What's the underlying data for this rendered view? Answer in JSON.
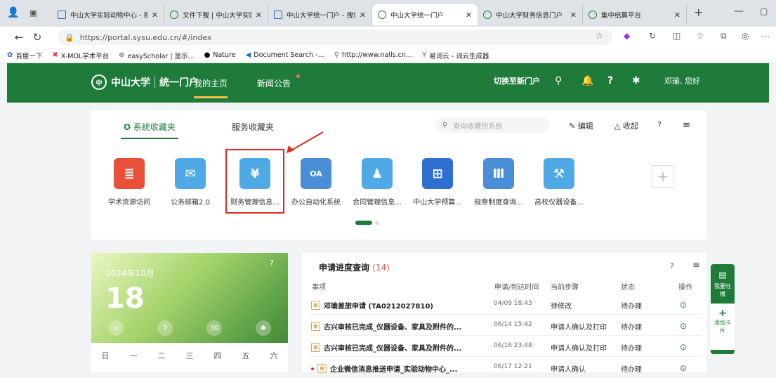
{
  "browser": {
    "tabs": [
      {
        "label": "中山大学实验动物中心 - 报",
        "icon": "search-icon"
      },
      {
        "label": "文件下载 | 中山大学实验动物",
        "icon": "site-icon"
      },
      {
        "label": "中山大学统一门户 - 搜索",
        "icon": "search-icon"
      },
      {
        "label": "中山大学统一门户",
        "icon": "site-icon"
      },
      {
        "label": "中山大学财务信息门户",
        "icon": "site-icon"
      },
      {
        "label": "集中结算平台",
        "icon": "site-icon"
      }
    ],
    "url": "https://portal.sysu.edu.cn/#/index",
    "bookmarks": [
      "百度一下",
      "X-MOL学术平台",
      "easyScholar | 显示...",
      "Nature",
      "Document Search -...",
      "http://www.nalls.cn...",
      "易词云 - 词云生成器"
    ]
  },
  "header": {
    "logo_text": "中山大学",
    "portal_name": "统一门户",
    "nav": [
      "我的主页",
      "新闻公告"
    ],
    "switch_label": "切换至新门户",
    "user_greeting": "邓瑜, 您好"
  },
  "favorites": {
    "tab_system": "系统收藏夹",
    "tab_service": "服务收藏夹",
    "search_placeholder": "查询收藏的系统",
    "edit_label": "编辑",
    "collapse_label": "收起",
    "apps": [
      {
        "label": "学术资源访问",
        "color": "#e8503a"
      },
      {
        "label": "公务邮箱2.0",
        "color": "#4ea9e6"
      },
      {
        "label": "财务管理信息...",
        "color": "#4ea9e6"
      },
      {
        "label": "办公自动化系统",
        "color": "#4a8ed8"
      },
      {
        "label": "合同管理信息...",
        "color": "#4ea9e6"
      },
      {
        "label": "中山大学预算...",
        "color": "#2f6fcf"
      },
      {
        "label": "规章制度查询...",
        "color": "#4a8ed8"
      },
      {
        "label": "高校仪器设备...",
        "color": "#4ea9e6"
      }
    ]
  },
  "calendar": {
    "year_month": "2024年10月",
    "day": "18",
    "weekdays": [
      "日",
      "一",
      "二",
      "三",
      "四",
      "五",
      "六"
    ]
  },
  "progress": {
    "title": "申请进度查询",
    "count": "(14)",
    "headers": [
      "事项",
      "申请/到达时间",
      "当前步骤",
      "状态",
      "操作"
    ],
    "rows": [
      {
        "title": "邓瑜差旅申请 (TA0212027810)",
        "time": "04/09 18:43",
        "step": "待修改",
        "status": "待办理"
      },
      {
        "title": "古兴审核已完成_仪器设备、家具及附件的...",
        "time": "06/14 15:42",
        "step": "申请人确认及打印",
        "status": "待办理"
      },
      {
        "title": "古兴审核已完成_仪器设备、家具及附件的...",
        "time": "06/16 23:48",
        "step": "申请人确认及打印",
        "status": "待办理"
      },
      {
        "title": "企业微信消息推送申请_实验动物中心_...",
        "time": "06/17 12:21",
        "step": "申请人确认",
        "status": "待办理"
      }
    ]
  },
  "sidefloat": {
    "feedback_label": "我要吐槽",
    "add_card_label": "添加卡片"
  },
  "colors": {
    "primary": "#1e7b3a",
    "highlight": "#e0281e"
  }
}
